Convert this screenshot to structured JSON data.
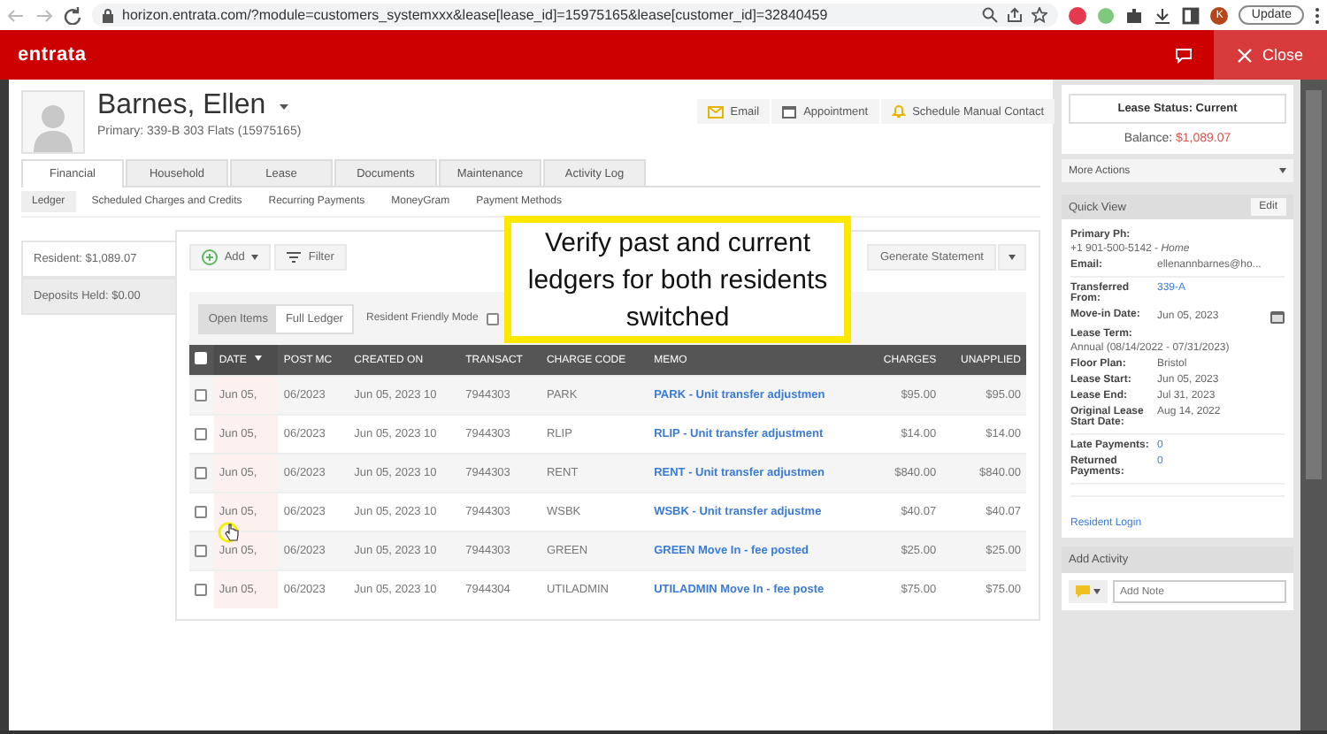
{
  "browser": {
    "url": "horizon.entrata.com/?module=customers_systemxxx&lease[lease_id]=15975165&lease[customer_id]=32840459",
    "profile_initial": "K",
    "update_label": "Update"
  },
  "app": {
    "logo": "entrata",
    "close_label": "Close"
  },
  "resident": {
    "name": "Barnes, Ellen",
    "primary": "Primary: 339-B 303 Flats (15975165)"
  },
  "contact_buttons": [
    {
      "label": "Email",
      "kind": "email"
    },
    {
      "label": "Appointment",
      "kind": "calendar"
    },
    {
      "label": "Schedule Manual Contact",
      "kind": "bell"
    }
  ],
  "tabs": [
    {
      "label": "Financial",
      "selected": true
    },
    {
      "label": "Household",
      "selected": false
    },
    {
      "label": "Lease",
      "selected": false
    },
    {
      "label": "Documents",
      "selected": false
    },
    {
      "label": "Maintenance",
      "selected": false
    },
    {
      "label": "Activity Log",
      "selected": false
    }
  ],
  "subtabs": [
    {
      "label": "Ledger",
      "selected": true
    },
    {
      "label": "Scheduled Charges and Credits",
      "selected": false
    },
    {
      "label": "Recurring Payments",
      "selected": false
    },
    {
      "label": "MoneyGram",
      "selected": false
    },
    {
      "label": "Payment Methods",
      "selected": false
    }
  ],
  "summary": [
    {
      "label": "Resident: $1,089.07",
      "selected": true
    },
    {
      "label": "Deposits Held: $0.00",
      "selected": false
    }
  ],
  "toolbar": {
    "add_label": "Add",
    "filter_label": "Filter",
    "generate_label": "Generate Statement"
  },
  "view_toggle": [
    {
      "label": "Open Items",
      "selected": true
    },
    {
      "label": "Full Ledger",
      "selected": false
    }
  ],
  "resident_friendly_mode": {
    "label": "Resident Friendly Mode",
    "checked": false
  },
  "table": {
    "select_all_checked": false,
    "columns": [
      "DATE",
      "POST MC",
      "CREATED ON",
      "TRANSACT",
      "CHARGE CODE",
      "MEMO",
      "CHARGES",
      "UNAPPLIED"
    ],
    "rows": [
      {
        "checked": false,
        "cells": [
          "Jun 05,",
          "06/2023",
          "Jun 05, 2023 10",
          "7944303",
          "PARK",
          "PARK - Unit transfer adjustmen",
          "$95.00",
          "$95.00"
        ]
      },
      {
        "checked": false,
        "cells": [
          "Jun 05,",
          "06/2023",
          "Jun 05, 2023 10",
          "7944303",
          "RLIP",
          "RLIP - Unit transfer adjustment",
          "$14.00",
          "$14.00"
        ]
      },
      {
        "checked": false,
        "cells": [
          "Jun 05,",
          "06/2023",
          "Jun 05, 2023 10",
          "7944303",
          "RENT",
          "RENT - Unit transfer adjustmen",
          "$840.00",
          "$840.00"
        ]
      },
      {
        "checked": false,
        "cells": [
          "Jun 05,",
          "06/2023",
          "Jun 05, 2023 10",
          "7944303",
          "WSBK",
          "WSBK - Unit transfer adjustme",
          "$40.07",
          "$40.07"
        ]
      },
      {
        "checked": false,
        "cells": [
          "Jun 05,",
          "06/2023",
          "Jun 05, 2023 10",
          "7944303",
          "GREEN",
          "GREEN Move In - fee posted",
          "$25.00",
          "$25.00"
        ]
      },
      {
        "checked": false,
        "cells": [
          "Jun 05,",
          "06/2023",
          "Jun 05, 2023 10",
          "7944304",
          "UTILADMIN",
          "UTILADMIN Move In - fee poste",
          "$75.00",
          "$75.00"
        ]
      }
    ]
  },
  "annotation": "Verify past and current ledgers for both residents switched",
  "sidebar": {
    "lease_status": "Lease Status: Current",
    "balance_label": "Balance:",
    "balance_value": "$1,089.07",
    "more_actions": "More Actions",
    "quick_view": {
      "title": "Quick View",
      "edit_label": "Edit",
      "groups": [
        [
          {
            "label": "Primary Ph:",
            "value": "+1 901-500-5142 - *Home*",
            "kind": "stacked"
          },
          {
            "label": "Email:",
            "value": "ellenannbarnes@ho...",
            "kind": "inline"
          }
        ],
        [
          {
            "label": "Transferred From:",
            "value": "339-A",
            "kind": "link"
          },
          {
            "label": "Move-in Date:",
            "value": "Jun 05, 2023",
            "kind": "date"
          },
          {
            "label": "Lease Term:",
            "value": "Annual (08/14/2022 - 07/31/2023)",
            "kind": "stacked"
          },
          {
            "label": "Floor Plan:",
            "value": "Bristol",
            "kind": "inline"
          },
          {
            "label": "Lease Start:",
            "value": "Jun 05, 2023",
            "kind": "inline"
          },
          {
            "label": "Lease End:",
            "value": "Jul 31, 2023",
            "kind": "inline"
          },
          {
            "label": "Original Lease Start Date:",
            "value": "Aug 14, 2022",
            "kind": "inline"
          }
        ],
        [
          {
            "label": "Late Payments:",
            "value": "0",
            "kind": "link"
          },
          {
            "label": "Returned Payments:",
            "value": "0",
            "kind": "link"
          }
        ]
      ],
      "resident_login": "Resident Login"
    },
    "add_activity": {
      "title": "Add Activity",
      "placeholder": "Add Note"
    }
  }
}
